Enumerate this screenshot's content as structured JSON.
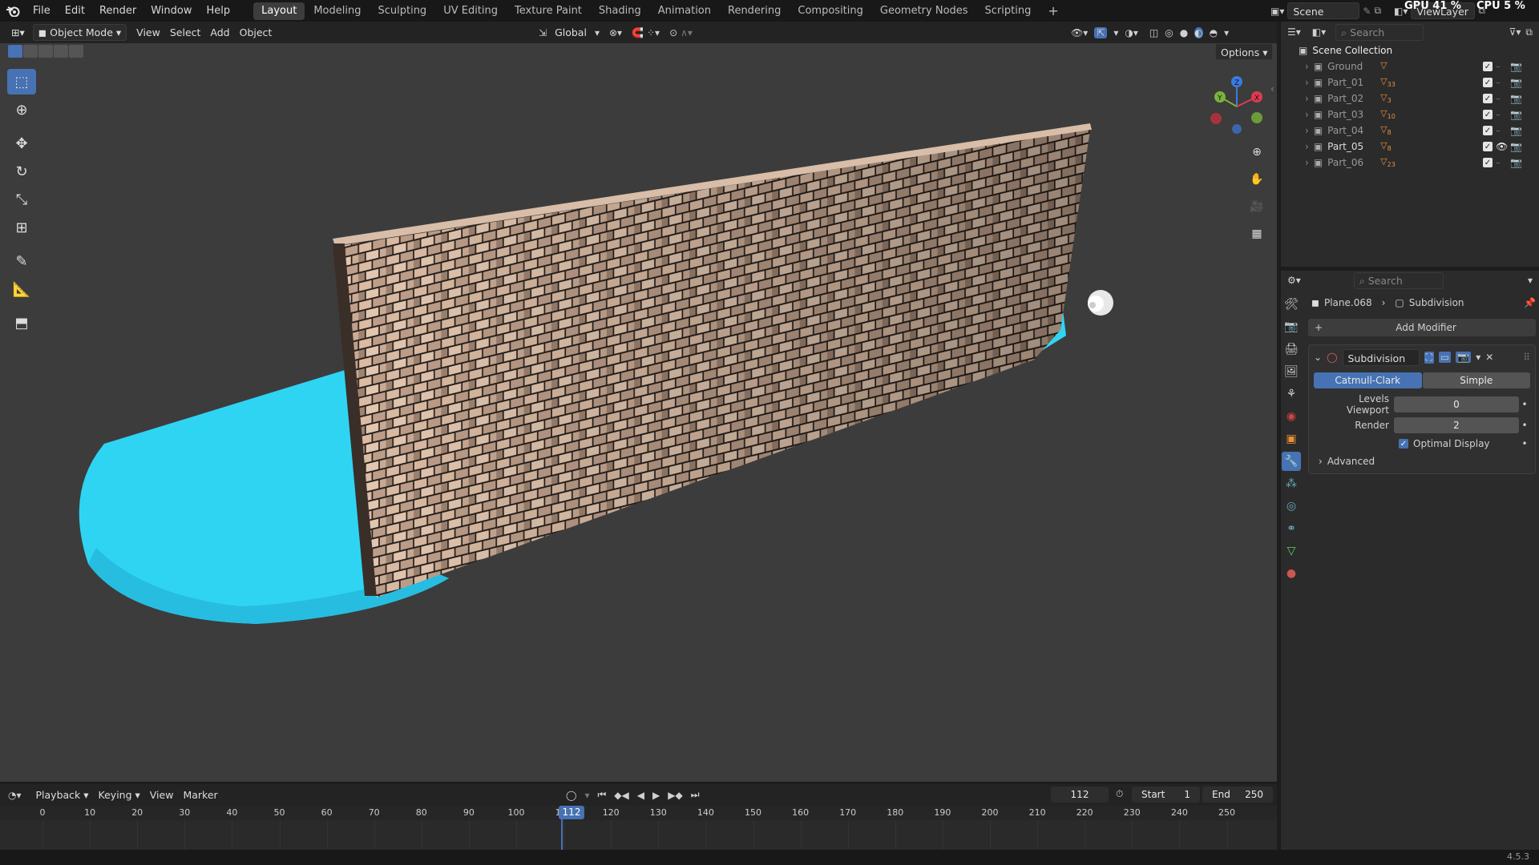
{
  "menus": [
    "File",
    "Edit",
    "Render",
    "Window",
    "Help"
  ],
  "workspaces": [
    {
      "label": "Layout",
      "active": true
    },
    {
      "label": "Modeling"
    },
    {
      "label": "Sculpting"
    },
    {
      "label": "UV Editing"
    },
    {
      "label": "Texture Paint"
    },
    {
      "label": "Shading"
    },
    {
      "label": "Animation"
    },
    {
      "label": "Rendering"
    },
    {
      "label": "Compositing"
    },
    {
      "label": "Geometry Nodes"
    },
    {
      "label": "Scripting"
    }
  ],
  "add_workspace": "+",
  "scene": {
    "label": "Scene",
    "view_layer": "ViewLayer"
  },
  "stats": {
    "gpu": "GPU 41 %",
    "cpu": "CPU 5 %"
  },
  "viewport_header": {
    "mode": "Object Mode",
    "menus": [
      "View",
      "Select",
      "Add",
      "Object"
    ],
    "orientation": "Global",
    "options": "Options"
  },
  "outliner": {
    "search_placeholder": "Search",
    "root": "Scene Collection",
    "items": [
      {
        "name": "Ground",
        "badge": ""
      },
      {
        "name": "Part_01",
        "badge": "33"
      },
      {
        "name": "Part_02",
        "badge": "3"
      },
      {
        "name": "Part_03",
        "badge": "10"
      },
      {
        "name": "Part_04",
        "badge": "8"
      },
      {
        "name": "Part_05",
        "badge": "8",
        "visible": true
      },
      {
        "name": "Part_06",
        "badge": "23"
      }
    ]
  },
  "properties": {
    "search_placeholder": "Search",
    "breadcrumb_object": "Plane.068",
    "breadcrumb_modifier": "Subdivision",
    "add_modifier": "Add Modifier",
    "modifier_name": "Subdivision",
    "method_options": [
      "Catmull-Clark",
      "Simple"
    ],
    "method_selected": "Catmull-Clark",
    "levels_viewport_label": "Levels Viewport",
    "levels_viewport": "0",
    "render_label": "Render",
    "render": "2",
    "optimal_display_label": "Optimal Display",
    "optimal_display": true,
    "advanced_label": "Advanced"
  },
  "timeline": {
    "menus": [
      "Playback",
      "Keying",
      "View",
      "Marker"
    ],
    "current_frame": "112",
    "start_label": "Start",
    "start": "1",
    "end_label": "End",
    "end": "250",
    "ticks": [
      "0",
      "10",
      "20",
      "30",
      "40",
      "50",
      "60",
      "70",
      "80",
      "90",
      "100",
      "110",
      "120",
      "130",
      "140",
      "150",
      "160",
      "170",
      "180",
      "190",
      "200",
      "210",
      "220",
      "230",
      "240",
      "250"
    ]
  },
  "version": "4.5.3",
  "colors": {
    "accent": "#4772b3",
    "cyan_ground": "#2ed3f2",
    "viewport_bg": "#3c3c3c",
    "playhead": "#4772b3"
  }
}
